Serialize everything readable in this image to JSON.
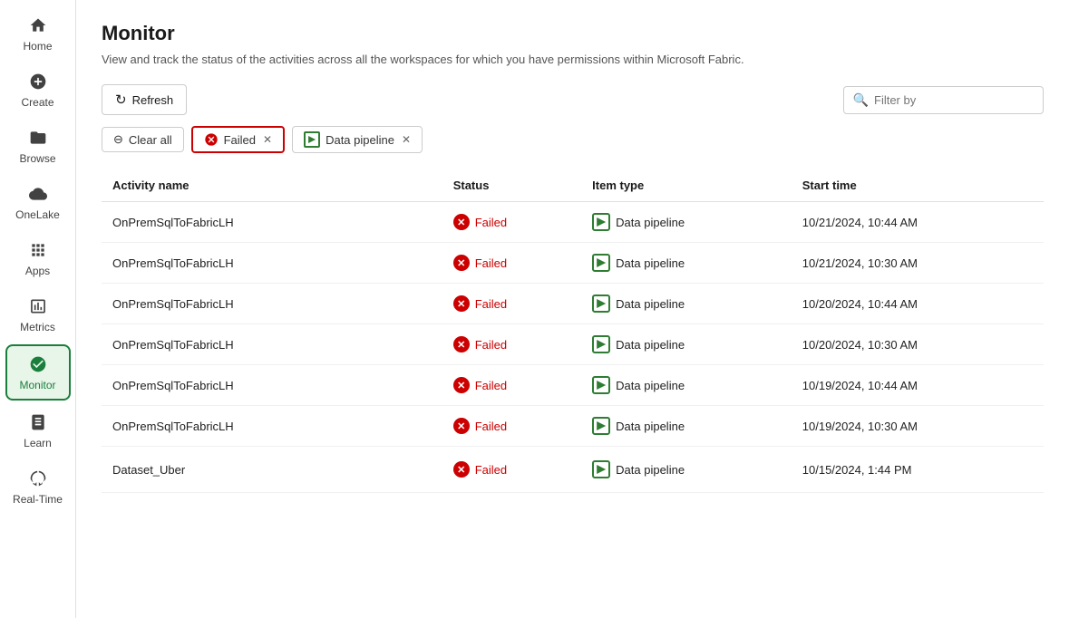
{
  "sidebar": {
    "items": [
      {
        "id": "home",
        "label": "Home",
        "icon": "home"
      },
      {
        "id": "create",
        "label": "Create",
        "icon": "create"
      },
      {
        "id": "browse",
        "label": "Browse",
        "icon": "browse"
      },
      {
        "id": "onelake",
        "label": "OneLake",
        "icon": "onelake"
      },
      {
        "id": "apps",
        "label": "Apps",
        "icon": "apps"
      },
      {
        "id": "metrics",
        "label": "Metrics",
        "icon": "metrics"
      },
      {
        "id": "monitor",
        "label": "Monitor",
        "icon": "monitor",
        "active": true
      },
      {
        "id": "learn",
        "label": "Learn",
        "icon": "learn"
      },
      {
        "id": "realtime",
        "label": "Real-Time",
        "icon": "realtime"
      }
    ]
  },
  "page": {
    "title": "Monitor",
    "subtitle": "View and track the status of the activities across all the workspaces for which you have permissions within Microsoft Fabric."
  },
  "toolbar": {
    "refresh_label": "Refresh",
    "filter_placeholder": "Filter by"
  },
  "filters": {
    "clear_label": "Clear all",
    "chips": [
      {
        "id": "failed",
        "label": "Failed",
        "active": true
      },
      {
        "id": "pipeline",
        "label": "Data pipeline"
      }
    ]
  },
  "table": {
    "columns": [
      {
        "id": "activity_name",
        "label": "Activity name"
      },
      {
        "id": "status",
        "label": "Status"
      },
      {
        "id": "item_type",
        "label": "Item type"
      },
      {
        "id": "start_time",
        "label": "Start time"
      }
    ],
    "rows": [
      {
        "activity_name": "OnPremSqlToFabricLH",
        "status": "Failed",
        "item_type": "Data pipeline",
        "start_time": "10/21/2024, 10:44 AM",
        "show_actions": false
      },
      {
        "activity_name": "OnPremSqlToFabricLH",
        "status": "Failed",
        "item_type": "Data pipeline",
        "start_time": "10/21/2024, 10:30 AM",
        "show_actions": false
      },
      {
        "activity_name": "OnPremSqlToFabricLH",
        "status": "Failed",
        "item_type": "Data pipeline",
        "start_time": "10/20/2024, 10:44 AM",
        "show_actions": false
      },
      {
        "activity_name": "OnPremSqlToFabricLH",
        "status": "Failed",
        "item_type": "Data pipeline",
        "start_time": "10/20/2024, 10:30 AM",
        "show_actions": false
      },
      {
        "activity_name": "OnPremSqlToFabricLH",
        "status": "Failed",
        "item_type": "Data pipeline",
        "start_time": "10/19/2024, 10:44 AM",
        "show_actions": false
      },
      {
        "activity_name": "OnPremSqlToFabricLH",
        "status": "Failed",
        "item_type": "Data pipeline",
        "start_time": "10/19/2024, 10:30 AM",
        "show_actions": false
      },
      {
        "activity_name": "Dataset_Uber",
        "status": "Failed",
        "item_type": "Data pipeline",
        "start_time": "10/15/2024, 1:44 PM",
        "show_actions": true
      }
    ]
  }
}
